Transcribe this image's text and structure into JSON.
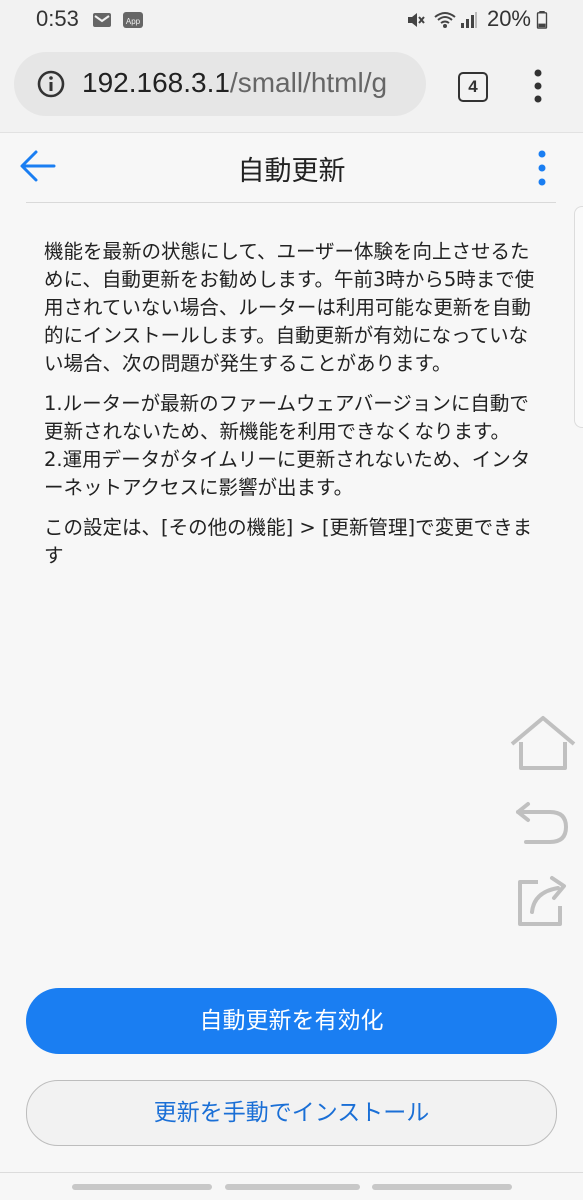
{
  "status_bar": {
    "time": "0:53",
    "battery": "20%",
    "icons": [
      "gmail-icon",
      "app-notification-icon",
      "mute-icon",
      "wifi-icon",
      "signal-icon",
      "battery-icon"
    ]
  },
  "browser": {
    "url_host": "192.168.3.1",
    "url_path": "/small/html/g",
    "tab_count": "4",
    "icons": [
      "info-icon",
      "tab-switcher-icon",
      "more-vert-icon"
    ]
  },
  "header": {
    "title": "自動更新",
    "icons": [
      "back-arrow-icon",
      "more-vert-icon"
    ]
  },
  "content": {
    "para1": "機能を最新の状態にして、ユーザー体験を向上させるために、自動更新をお勧めします。午前3時から5時まで使用されていない場合、ルーターは利用可能な更新を自動的にインストールします。自動更新が有効になっていない場合、次の問題が発生することがあります。",
    "para2": "1.ルーターが最新のファームウェアバージョンに自動で更新されないため、新機能を利用できなくなります。",
    "para3": "2.運用データがタイムリーに更新されないため、インターネットアクセスに影響が出ます。",
    "para4": "この設定は、[その他の機能] > [更新管理]で変更できます"
  },
  "floating_icons": [
    "home-icon",
    "undo-icon",
    "share-icon"
  ],
  "buttons": {
    "primary": "自動更新を有効化",
    "secondary": "更新を手動でインストール"
  },
  "colors": {
    "accent": "#1a7ef2",
    "secondary_text": "#1a6fd6",
    "background": "#f7f7f7"
  }
}
